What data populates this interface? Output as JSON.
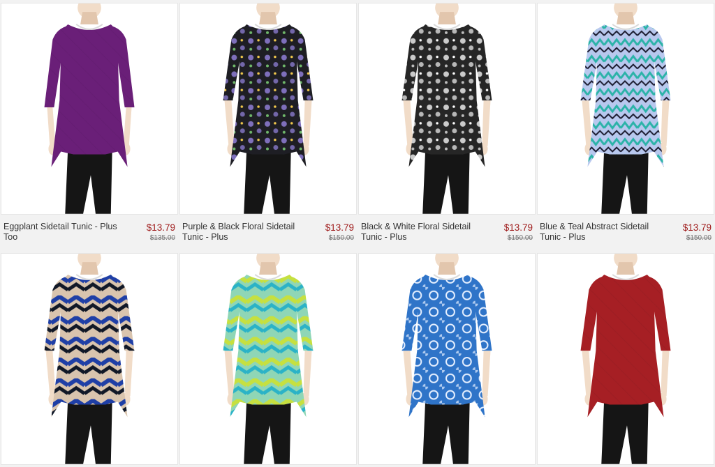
{
  "products": [
    {
      "name": "Eggplant Sidetail Tunic - Plus Too",
      "price": "$13.79",
      "original_price": "$135.00",
      "color": "#6a1f78",
      "accent": "#5b1968",
      "pattern": "solid",
      "sleeve": "long"
    },
    {
      "name": "Purple & Black Floral Sidetail Tunic - Plus",
      "price": "$13.79",
      "original_price": "$150.00",
      "color": "#1e1e24",
      "accent": "#8f7ed6",
      "pattern": "floral",
      "sleeve": "three-quarter"
    },
    {
      "name": "Black & White Floral Sidetail Tunic - Plus",
      "price": "$13.79",
      "original_price": "$150.00",
      "color": "#262626",
      "accent": "#e8e8e8",
      "pattern": "floral",
      "sleeve": "three-quarter"
    },
    {
      "name": "Blue & Teal Abstract Sidetail Tunic - Plus",
      "price": "$13.79",
      "original_price": "$150.00",
      "color": "#b8c8ee",
      "accent": "#2bb3a8",
      "pattern": "abstract",
      "sleeve": "three-quarter"
    },
    {
      "name": "",
      "price": "",
      "original_price": "",
      "color": "#d9c4ae",
      "accent": "#1f3fa6",
      "pattern": "chevron",
      "sleeve": "three-quarter"
    },
    {
      "name": "",
      "price": "",
      "original_price": "",
      "color": "#8fd6b6",
      "accent": "#c6e040",
      "pattern": "chevron",
      "sleeve": "three-quarter"
    },
    {
      "name": "",
      "price": "",
      "original_price": "",
      "color": "#2f74c8",
      "accent": "#e7f0ff",
      "pattern": "damask",
      "sleeve": "three-quarter"
    },
    {
      "name": "",
      "price": "",
      "original_price": "",
      "color": "#a61f24",
      "accent": "#8e1a1f",
      "pattern": "solid",
      "sleeve": "three-quarter"
    }
  ]
}
